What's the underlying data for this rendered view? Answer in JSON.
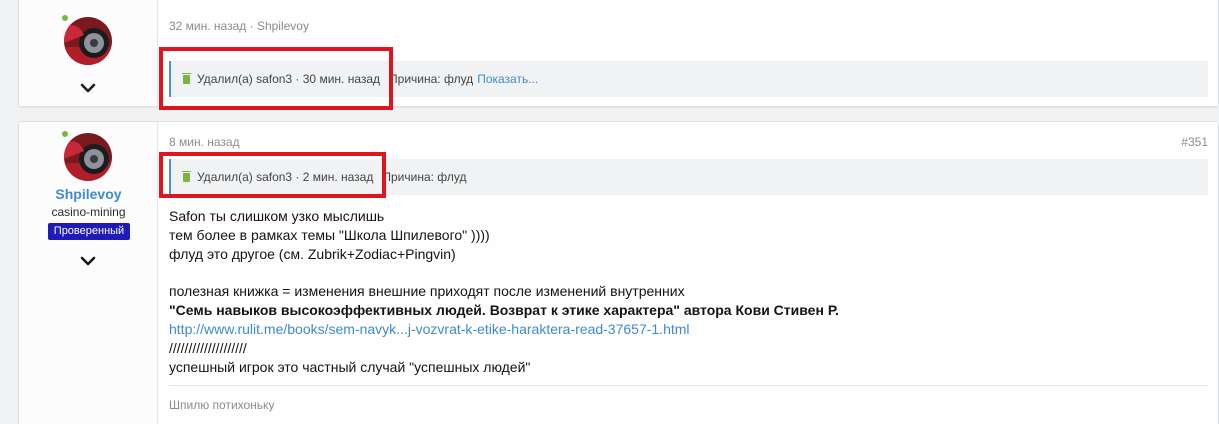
{
  "posts": [
    {
      "meta": "32 мин. назад · Shpilevoy",
      "deleted": {
        "by": "Удалил(а) safon3 · 30 мин. назад",
        "reason": "Причина: флуд",
        "show_label": "Показать..."
      }
    },
    {
      "username": "Shpilevoy",
      "user_title": "casino-mining",
      "badge": "Проверенный",
      "meta": "8 мин. назад",
      "post_number": "#351",
      "deleted": {
        "by": "Удалил(а) safon3 · 2 мин. назад",
        "reason": "Причина: флуд"
      },
      "body": {
        "line1": "Safon ты слишком узко мыслишь",
        "line2": "тем более в рамках темы \"Школа Шпилевого\" ))))",
        "line3": "флуд это другое (см. Zubrik+Zodiac+Pingvin)",
        "line4": "полезная книжка = изменения внешние приходят после изменений внутренних",
        "line5": "\"Семь навыков высокоэффективных людей. Возврат к этике характера\" автора Кови Стивен Р.",
        "link": "http://www.rulit.me/books/sem-navyk...j-vozvrat-k-etike-haraktera-read-37657-1.html",
        "line7": "////////////////////",
        "line8": "успешный игрок это частный случай \"успешных людей\""
      },
      "signature": "Шпилю потихоньку"
    }
  ],
  "colors": {
    "accent": "#3f8bd0",
    "online": "#6fbb3f",
    "badge_bg": "#1f1ab8",
    "highlight": "#e0141c",
    "trash": "#7cb342"
  }
}
